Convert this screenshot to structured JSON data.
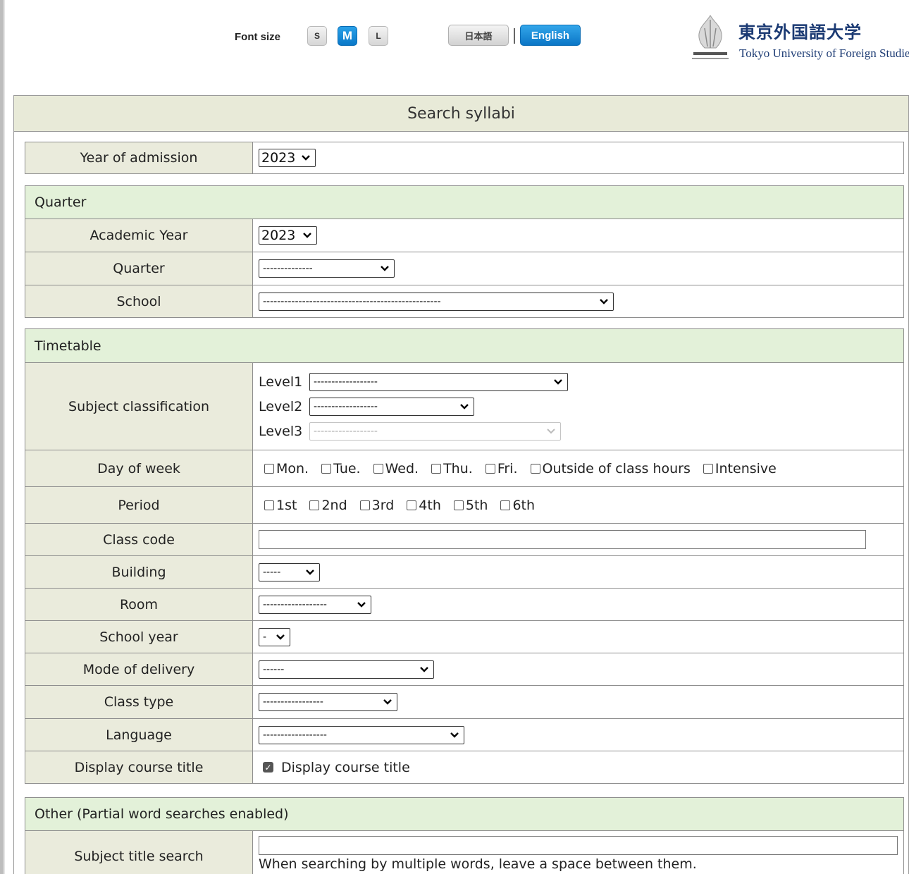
{
  "header": {
    "font_size_label": "Font size",
    "font_sizes": [
      "S",
      "M",
      "L"
    ],
    "font_size_active": "M",
    "lang_ja": "日本語",
    "lang_en": "English",
    "logo_ja": "東京外国語大学",
    "logo_en": "Tokyo University of Foreign Studies"
  },
  "title": "Search syllabi",
  "admission": {
    "label": "Year of admission",
    "value": "2023"
  },
  "quarter_section": {
    "heading": "Quarter",
    "academic_year": {
      "label": "Academic Year",
      "value": "2023"
    },
    "quarter": {
      "label": "Quarter",
      "value": "--------------"
    },
    "school": {
      "label": "School",
      "value": "--------------------------------------------------"
    }
  },
  "timetable_section": {
    "heading": "Timetable",
    "subject_classification": {
      "label": "Subject classification",
      "levels": [
        {
          "label": "Level1",
          "value": "------------------"
        },
        {
          "label": "Level2",
          "value": "------------------"
        },
        {
          "label": "Level3",
          "value": "------------------"
        }
      ]
    },
    "day_of_week": {
      "label": "Day of week",
      "options": [
        "Mon.",
        "Tue.",
        "Wed.",
        "Thu.",
        "Fri.",
        "Outside of class hours",
        "Intensive"
      ]
    },
    "period": {
      "label": "Period",
      "options": [
        "1st",
        "2nd",
        "3rd",
        "4th",
        "5th",
        "6th"
      ]
    },
    "class_code": {
      "label": "Class code",
      "value": ""
    },
    "building": {
      "label": "Building",
      "value": "-----"
    },
    "room": {
      "label": "Room",
      "value": "------------------"
    },
    "school_year": {
      "label": "School year",
      "value": "-"
    },
    "mode_of_delivery": {
      "label": "Mode of delivery",
      "value": "------"
    },
    "class_type": {
      "label": "Class type",
      "value": "-----------------"
    },
    "language": {
      "label": "Language",
      "value": "------------------"
    },
    "display_course_title": {
      "label": "Display course title",
      "checkbox_label": "Display course title",
      "checked": true
    }
  },
  "other_section": {
    "heading": "Other (Partial word searches enabled)",
    "subject_title_search": {
      "label": "Subject title search",
      "value": "",
      "hint": "When searching by multiple words, leave a space between them."
    }
  }
}
